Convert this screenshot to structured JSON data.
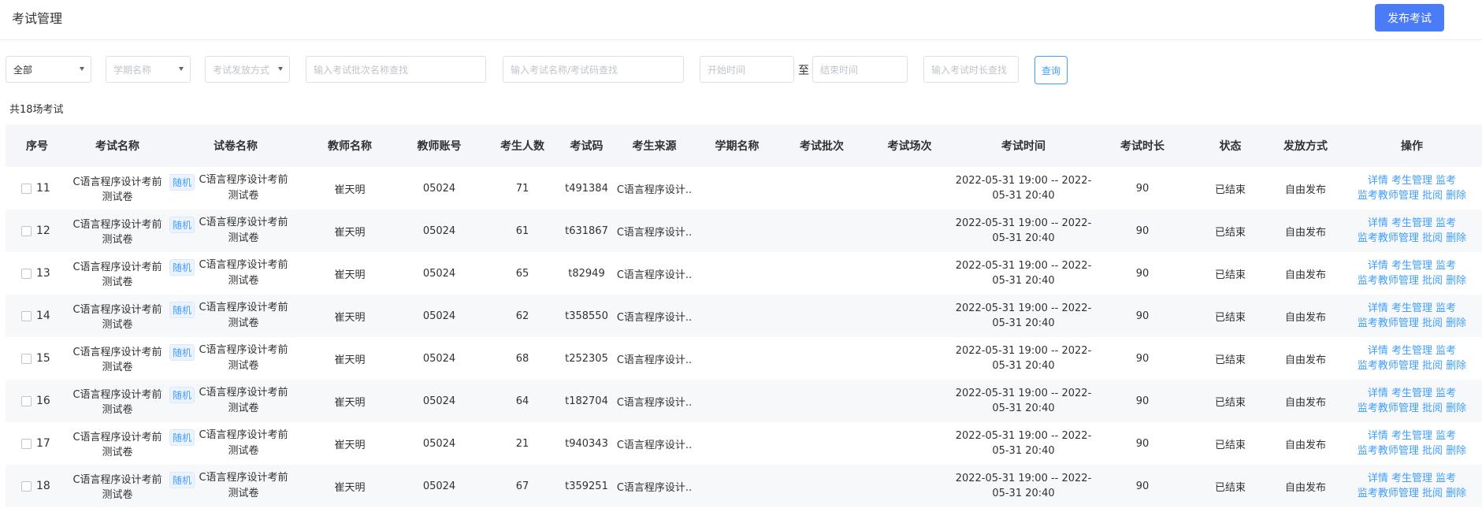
{
  "page_title": "考试管理",
  "publish_button": "发布考试",
  "filters": {
    "all_value": "全部",
    "semester_placeholder": "学期名称",
    "issue_method_placeholder": "考试发放方式",
    "batch_search_placeholder": "输入考试批次名称查找",
    "name_code_search_placeholder": "输入考试名称/考试码查找",
    "start_time_placeholder": "开始时间",
    "range_separator": "至",
    "end_time_placeholder": "结束时间",
    "duration_search_placeholder": "输入考试时长查找",
    "query_button": "查询"
  },
  "total_label": "共18场考试",
  "columns": [
    "序号",
    "考试名称",
    "试卷名称",
    "教师名称",
    "教师账号",
    "考生人数",
    "考试码",
    "考生来源",
    "学期名称",
    "考试批次",
    "考试场次",
    "考试时间",
    "考试时长",
    "状态",
    "发放方式",
    "操作"
  ],
  "row_tag": "随机",
  "operations": {
    "detail": "详情",
    "students": "考生管理",
    "proctor": "监考",
    "proctor_teachers": "监考教师管理",
    "grade": "批阅",
    "delete": "删除"
  },
  "rows": [
    {
      "seq": "11",
      "exam_name": "C语言程序设计考前测试卷",
      "paper_name": "C语言程序设计考前测试卷",
      "teacher": "崔天明",
      "account": "05024",
      "count": "71",
      "code": "t491384",
      "source": "C语言程序设计..",
      "semester": "",
      "batch": "",
      "session": "",
      "time": "2022-05-31 19:00 -- 2022-05-31 20:40",
      "duration": "90",
      "status": "已结束",
      "method": "自由发布"
    },
    {
      "seq": "12",
      "exam_name": "C语言程序设计考前测试卷",
      "paper_name": "C语言程序设计考前测试卷",
      "teacher": "崔天明",
      "account": "05024",
      "count": "61",
      "code": "t631867",
      "source": "C语言程序设计..",
      "semester": "",
      "batch": "",
      "session": "",
      "time": "2022-05-31 19:00 -- 2022-05-31 20:40",
      "duration": "90",
      "status": "已结束",
      "method": "自由发布"
    },
    {
      "seq": "13",
      "exam_name": "C语言程序设计考前测试卷",
      "paper_name": "C语言程序设计考前测试卷",
      "teacher": "崔天明",
      "account": "05024",
      "count": "65",
      "code": "t82949",
      "source": "C语言程序设计..",
      "semester": "",
      "batch": "",
      "session": "",
      "time": "2022-05-31 19:00 -- 2022-05-31 20:40",
      "duration": "90",
      "status": "已结束",
      "method": "自由发布"
    },
    {
      "seq": "14",
      "exam_name": "C语言程序设计考前测试卷",
      "paper_name": "C语言程序设计考前测试卷",
      "teacher": "崔天明",
      "account": "05024",
      "count": "62",
      "code": "t358550",
      "source": "C语言程序设计..",
      "semester": "",
      "batch": "",
      "session": "",
      "time": "2022-05-31 19:00 -- 2022-05-31 20:40",
      "duration": "90",
      "status": "已结束",
      "method": "自由发布"
    },
    {
      "seq": "15",
      "exam_name": "C语言程序设计考前测试卷",
      "paper_name": "C语言程序设计考前测试卷",
      "teacher": "崔天明",
      "account": "05024",
      "count": "68",
      "code": "t252305",
      "source": "C语言程序设计..",
      "semester": "",
      "batch": "",
      "session": "",
      "time": "2022-05-31 19:00 -- 2022-05-31 20:40",
      "duration": "90",
      "status": "已结束",
      "method": "自由发布"
    },
    {
      "seq": "16",
      "exam_name": "C语言程序设计考前测试卷",
      "paper_name": "C语言程序设计考前测试卷",
      "teacher": "崔天明",
      "account": "05024",
      "count": "64",
      "code": "t182704",
      "source": "C语言程序设计..",
      "semester": "",
      "batch": "",
      "session": "",
      "time": "2022-05-31 19:00 -- 2022-05-31 20:40",
      "duration": "90",
      "status": "已结束",
      "method": "自由发布"
    },
    {
      "seq": "17",
      "exam_name": "C语言程序设计考前测试卷",
      "paper_name": "C语言程序设计考前测试卷",
      "teacher": "崔天明",
      "account": "05024",
      "count": "21",
      "code": "t940343",
      "source": "C语言程序设计..",
      "semester": "",
      "batch": "",
      "session": "",
      "time": "2022-05-31 19:00 -- 2022-05-31 20:40",
      "duration": "90",
      "status": "已结束",
      "method": "自由发布"
    },
    {
      "seq": "18",
      "exam_name": "C语言程序设计考前测试卷",
      "paper_name": "C语言程序设计考前测试卷",
      "teacher": "崔天明",
      "account": "05024",
      "count": "67",
      "code": "t359251",
      "source": "C语言程序设计..",
      "semester": "",
      "batch": "",
      "session": "",
      "time": "2022-05-31 19:00 -- 2022-05-31 20:40",
      "duration": "90",
      "status": "已结束",
      "method": "自由发布"
    }
  ]
}
